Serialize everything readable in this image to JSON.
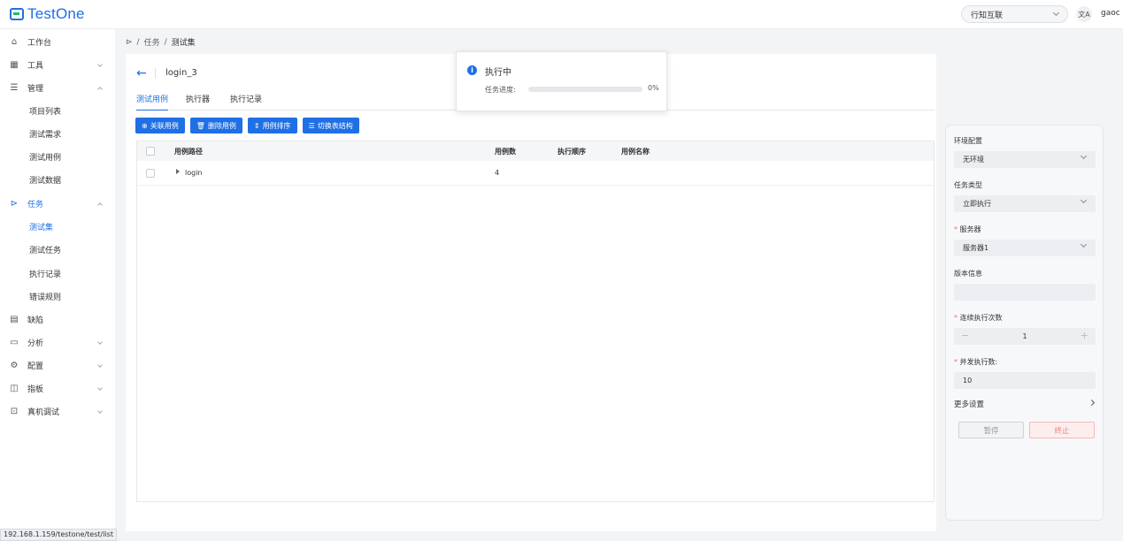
{
  "app": {
    "name": "TestOne"
  },
  "header": {
    "org": "行知互联",
    "lang_icon": "文A",
    "user": "gaoc"
  },
  "sidebar": {
    "items": [
      {
        "label": "工作台",
        "icon": "home-icon"
      },
      {
        "label": "工具",
        "icon": "grid-icon"
      },
      {
        "label": "管理",
        "icon": "list-icon"
      },
      {
        "label": "项目列表"
      },
      {
        "label": "测试需求"
      },
      {
        "label": "测试用例"
      },
      {
        "label": "测试数据"
      },
      {
        "label": "任务",
        "icon": "play-icon"
      },
      {
        "label": "测试集"
      },
      {
        "label": "测试任务"
      },
      {
        "label": "执行记录"
      },
      {
        "label": "错误规则"
      },
      {
        "label": "缺陷",
        "icon": "document-icon"
      },
      {
        "label": "分析",
        "icon": "calendar-icon"
      },
      {
        "label": "配置",
        "icon": "gear-icon"
      },
      {
        "label": "指板",
        "icon": "board-icon"
      },
      {
        "label": "真机调试",
        "icon": "device-icon"
      }
    ]
  },
  "breadcrumb": {
    "items": [
      "任务",
      "测试集"
    ]
  },
  "page": {
    "title": "login_3"
  },
  "tabs": [
    "测试用例",
    "执行器",
    "执行记录"
  ],
  "toolbar": {
    "link_case": "关联用例",
    "delete_case": "删除用例",
    "sort_case": "用例排序",
    "toggle_structure": "切换表结构"
  },
  "table": {
    "headers": {
      "path": "用例路径",
      "count": "用例数",
      "order": "执行顺序",
      "name": "用例名称"
    },
    "rows": [
      {
        "path": "login",
        "count": "4",
        "order": "",
        "name": ""
      }
    ]
  },
  "popup": {
    "title": "执行中",
    "progress_label": "任务进度:",
    "progress_value": 0,
    "progress_text": "0%"
  },
  "settings": {
    "env_label": "环境配置",
    "env_value": "无环境",
    "task_type_label": "任务类型",
    "task_type_value": "立即执行",
    "server_label": "服务器",
    "server_value": "服务器1",
    "version_label": "版本信息",
    "version_value": "",
    "repeat_label": "连续执行次数",
    "repeat_value": "1",
    "concurrency_label": "并发执行数:",
    "concurrency_value": "10",
    "more_label": "更多设置",
    "pause_label": "暂停",
    "stop_label": "终止"
  },
  "status_url": "192.168.1.159/testone/test/list",
  "colors": {
    "accent": "#1f6fe5",
    "danger": "#f56c6c",
    "logo_green": "#2bb673"
  }
}
